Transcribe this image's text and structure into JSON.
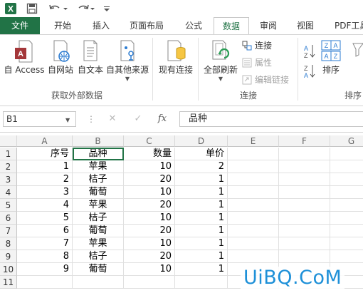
{
  "quick_access": {
    "excel_logo": "X",
    "save_icon": "save-icon",
    "undo_icon": "undo-icon",
    "redo_icon": "redo-icon"
  },
  "tabs": [
    "文件",
    "开始",
    "插入",
    "页面布局",
    "公式",
    "数据",
    "审阅",
    "视图",
    "PDF工具"
  ],
  "active_tab": "数据",
  "ribbon": {
    "get_external": {
      "buttons": [
        "自 Access",
        "自网站",
        "自文本",
        "自其他来源"
      ],
      "label": "获取外部数据"
    },
    "existing_conn": "现有连接",
    "refresh_all": "全部刷新",
    "connections": {
      "items": [
        "连接",
        "属性",
        "编辑链接"
      ],
      "label": "连接"
    },
    "sort": "排序",
    "sort_group_label": "排序"
  },
  "formula_bar": {
    "name_box": "B1",
    "cancel": "✕",
    "confirm": "✓",
    "fx": "fx",
    "value": "品种"
  },
  "columns": [
    "A",
    "B",
    "C",
    "D",
    "E",
    "F",
    "G"
  ],
  "rows": [
    "1",
    "2",
    "3",
    "4",
    "5",
    "6",
    "7",
    "8",
    "9",
    "10",
    "11"
  ],
  "table": [
    [
      "序号",
      "品种",
      "数量",
      "单价"
    ],
    [
      "1",
      "苹果",
      "10",
      "2"
    ],
    [
      "2",
      "桔子",
      "20",
      "1"
    ],
    [
      "3",
      "葡萄",
      "10",
      "1"
    ],
    [
      "4",
      "苹果",
      "20",
      "1"
    ],
    [
      "5",
      "桔子",
      "10",
      "1"
    ],
    [
      "6",
      "葡萄",
      "20",
      "1"
    ],
    [
      "7",
      "苹果",
      "10",
      "1"
    ],
    [
      "8",
      "桔子",
      "20",
      "1"
    ],
    [
      "9",
      "葡萄",
      "10",
      "1"
    ]
  ],
  "watermark": "UiBQ.CoM",
  "colors": {
    "accent": "#217346",
    "watermark": "#1e90d8"
  }
}
